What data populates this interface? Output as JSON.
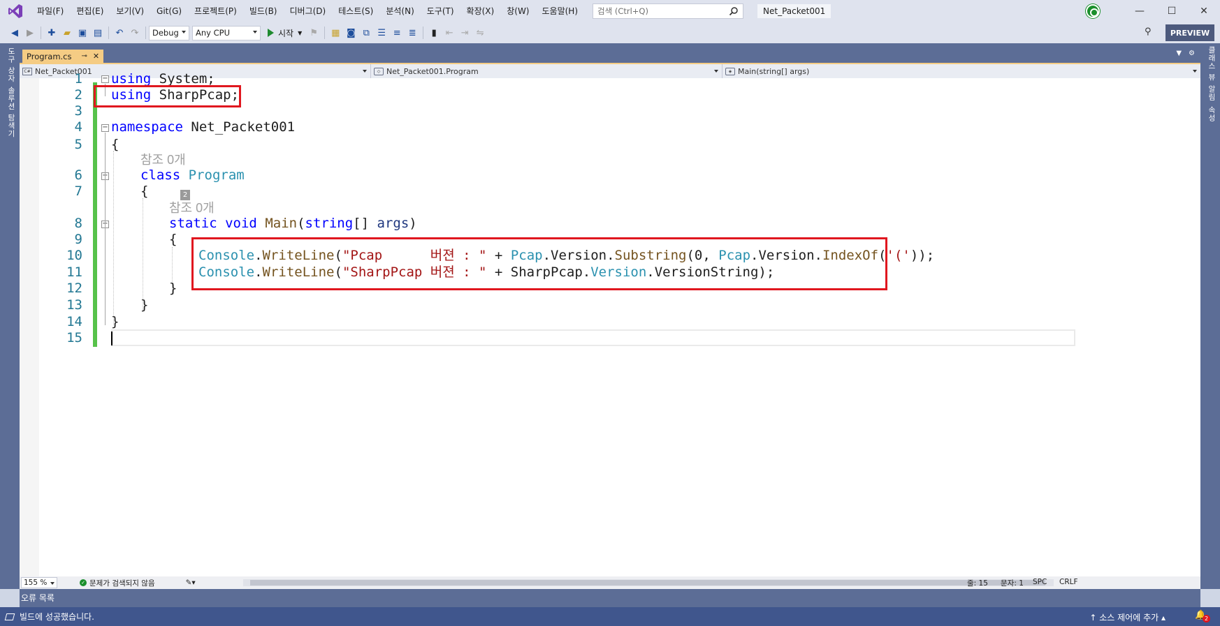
{
  "menu": {
    "items": [
      "파일(F)",
      "편집(E)",
      "보기(V)",
      "Git(G)",
      "프로젝트(P)",
      "빌드(B)",
      "디버그(D)",
      "테스트(S)",
      "분석(N)",
      "도구(T)",
      "확장(X)",
      "창(W)",
      "도움말(H)"
    ],
    "search_placeholder": "검색 (Ctrl+Q)",
    "solution_name": "Net_Packet001"
  },
  "toolbar": {
    "config": "Debug",
    "platform": "Any CPU",
    "start_label": "시작",
    "preview_label": "PREVIEW"
  },
  "side_tabs": {
    "left_top": "도구 상자",
    "left_bottom": "솔루션 탐색기",
    "right_top": "클래스 뷰",
    "right_mid": "알림",
    "right_bottom": "속성"
  },
  "document_tab": {
    "label": "Program.cs"
  },
  "navbar": {
    "project": "Net_Packet001",
    "type": "Net_Packet001.Program",
    "member": "Main(string[] args)"
  },
  "code": {
    "line_numbers": [
      "1",
      "2",
      "3",
      "4",
      "5",
      "6",
      "7",
      "8",
      "9",
      "10",
      "11",
      "12",
      "13",
      "14",
      "15"
    ],
    "codelens_ref": "참조 0개",
    "badge": "2",
    "line1": {
      "kw": "using",
      "rest": " System;"
    },
    "line2": {
      "kw": "using",
      "rest": " SharpPcap;"
    },
    "line4": {
      "kw": "namespace",
      "rest": " Net_Packet001"
    },
    "line5": "{",
    "line6": {
      "kw": "class",
      "ty": "Program"
    },
    "line7": "{",
    "line8": {
      "kw1": "static",
      "kw2": "void",
      "mt": "Main",
      "p1": "(",
      "kw3": "string",
      "p2": "[] ",
      "pm": "args",
      "p3": ")"
    },
    "line9": "{",
    "line10": {
      "t1": "Console",
      "d1": ".",
      "m1": "WriteLine",
      "p1": "(",
      "s1": "\"Pcap      버젼 : \"",
      "p2": " + ",
      "t2": "Pcap",
      "p3": ".Version.",
      "m2": "Substring",
      "p4": "(0, ",
      "t3": "Pcap",
      "p5": ".Version.",
      "m3": "IndexOf",
      "p6": "(",
      "s2": "'('",
      "p7": "));"
    },
    "line11": {
      "t1": "Console",
      "d1": ".",
      "m1": "WriteLine",
      "p1": "(",
      "s1": "\"SharpPcap 버젼 : \"",
      "p2": " + SharpPcap.",
      "t2": "Version",
      "p3": ".VersionString);"
    },
    "line12": "}",
    "line13": "}",
    "line14": "}"
  },
  "editor_status": {
    "zoom": "155 %",
    "issues": "문제가 검색되지 않음",
    "line": "줄: 15",
    "col": "문자: 1",
    "indent": "SPC",
    "eol": "CRLF"
  },
  "bottom_tab": {
    "label": "오류 목록"
  },
  "statusbar": {
    "message": "빌드에 성공했습니다.",
    "source_control": "소스 제어에 추가",
    "notifications": "2"
  },
  "colors": {
    "highlight_box": "#e0171f",
    "change_bar": "#57c24a",
    "statusbar": "#40568d",
    "tab_active": "#f5cc84"
  }
}
